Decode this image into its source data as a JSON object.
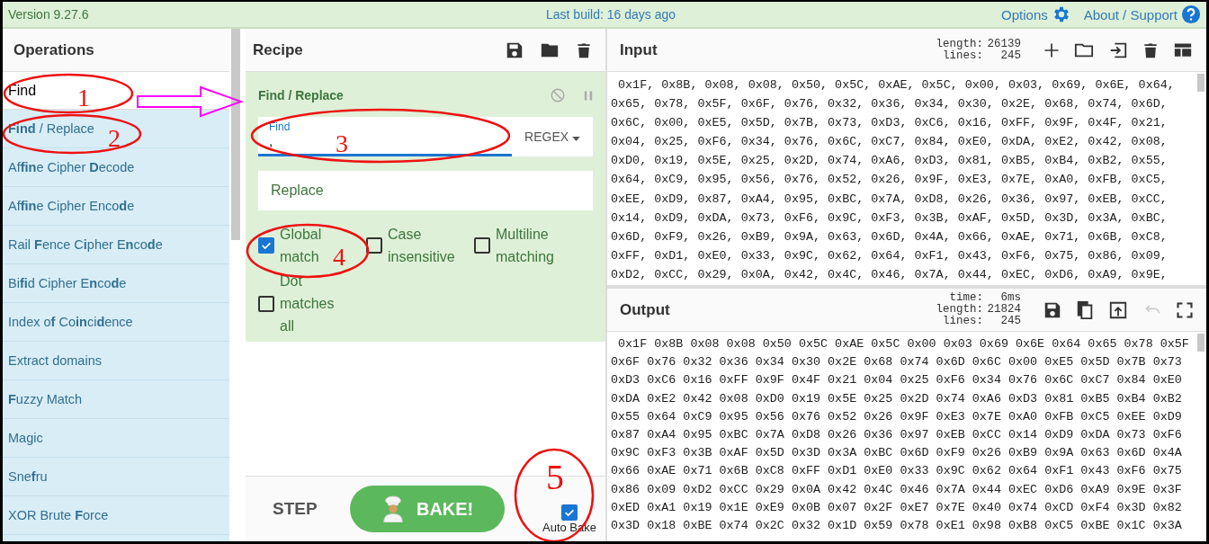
{
  "top_bar": {
    "version": "Version 9.27.6",
    "last_build": "Last build: 16 days ago",
    "options": "Options",
    "about": "About / Support"
  },
  "operations": {
    "title": "Operations",
    "search": {
      "value": "Find"
    },
    "items": [
      {
        "label": "**Find** / Replace"
      },
      {
        "label": "Af**fin**e Cipher **D**ecode"
      },
      {
        "label": "Af**fin**e Cipher Enco**d**e"
      },
      {
        "label": "Rail **F**ence C**i**pher E**n**co**d**e"
      },
      {
        "label": "Bi**fi**d Cipher E**n**co**d**e"
      },
      {
        "label": "Index o**f** Co**in**ci**d**ence"
      },
      {
        "label": "Extract domains"
      },
      {
        "label": "**F**uzzy Match"
      },
      {
        "label": "Magic"
      },
      {
        "label": "Sne**f**ru"
      },
      {
        "label": "XOR Brute **F**orce"
      }
    ]
  },
  "recipe": {
    "title": "Recipe",
    "operation": {
      "title": "Find / Replace",
      "find": {
        "label": "Find",
        "value": ",",
        "mode": "REGEX"
      },
      "replace": {
        "placeholder": "Replace"
      },
      "options": [
        {
          "label": "Global match",
          "checked": true
        },
        {
          "label": "Case insensitive",
          "checked": false
        },
        {
          "label": "Multiline matching",
          "checked": false
        },
        {
          "label": "Dot matches all",
          "checked": false
        }
      ]
    },
    "step": "STEP",
    "bake": "BAKE!",
    "auto_bake": {
      "label": "Auto Bake",
      "checked": true
    }
  },
  "input": {
    "title": "Input",
    "stats": [
      {
        "label": "length:",
        "value": "26139"
      },
      {
        "label": "lines:",
        "value": "245"
      }
    ],
    "lines": [
      " 0x1F, 0x8B, 0x08, 0x08, 0x50, 0x5C, 0xAE, 0x5C, 0x00, 0x03, 0x69, 0x6E, 0x64,",
      "0x65, 0x78, 0x5F, 0x6F, 0x76, 0x32, 0x36, 0x34, 0x30, 0x2E, 0x68, 0x74, 0x6D,",
      "0x6C, 0x00, 0xE5, 0x5D, 0x7B, 0x73, 0xD3, 0xC6, 0x16, 0xFF, 0x9F, 0x4F, 0x21,",
      "0x04, 0x25, 0xF6, 0x34, 0x76, 0x6C, 0xC7, 0x84, 0xE0, 0xDA, 0xE2, 0x42, 0x08,",
      "0xD0, 0x19, 0x5E, 0x25, 0x2D, 0x74, 0xA6, 0xD3, 0x81, 0xB5, 0xB4, 0xB2, 0x55,",
      "0x64, 0xC9, 0x95, 0x56, 0x76, 0x52, 0x26, 0x9F, 0xE3, 0x7E, 0xA0, 0xFB, 0xC5,",
      "0xEE, 0xD9, 0x87, 0xA4, 0x95, 0xBC, 0x7A, 0xD8, 0x26, 0x36, 0x97, 0xEB, 0xCC,",
      "0x14, 0xD9, 0xDA, 0x73, 0xF6, 0x9C, 0xF3, 0x3B, 0xAF, 0x5D, 0x3D, 0x3A, 0xBC,",
      "0x6D, 0xF9, 0x26, 0xB9, 0x9A, 0x63, 0x6D, 0x4A, 0x66, 0xAE, 0x71, 0x6B, 0xC8,",
      "0xFF, 0xD1, 0xE0, 0x33, 0x9C, 0x62, 0x64, 0xF1, 0x43, 0xF6, 0x75, 0x86, 0x09,",
      "0xD2, 0xCC, 0x29, 0x0A, 0x42, 0x4C, 0x46, 0x7A, 0x44, 0xEC, 0xD6, 0xA9, 0x9E,"
    ]
  },
  "output": {
    "title": "Output",
    "stats": [
      {
        "label": "time:",
        "value": "6ms"
      },
      {
        "label": "length:",
        "value": "21824"
      },
      {
        "label": "lines:",
        "value": "245"
      }
    ],
    "lines": [
      " 0x1F 0x8B 0x08 0x08 0x50 0x5C 0xAE 0x5C 0x00 0x03 0x69 0x6E 0x64 0x65 0x78 0x5F",
      "0x6F 0x76 0x32 0x36 0x34 0x30 0x2E 0x68 0x74 0x6D 0x6C 0x00 0xE5 0x5D 0x7B 0x73",
      "0xD3 0xC6 0x16 0xFF 0x9F 0x4F 0x21 0x04 0x25 0xF6 0x34 0x76 0x6C 0xC7 0x84 0xE0",
      "0xDA 0xE2 0x42 0x08 0xD0 0x19 0x5E 0x25 0x2D 0x74 0xA6 0xD3 0x81 0xB5 0xB4 0xB2",
      "0x55 0x64 0xC9 0x95 0x56 0x76 0x52 0x26 0x9F 0xE3 0x7E 0xA0 0xFB 0xC5 0xEE 0xD9",
      "0x87 0xA4 0x95 0xBC 0x7A 0xD8 0x26 0x36 0x97 0xEB 0xCC 0x14 0xD9 0xDA 0x73 0xF6",
      "0x9C 0xF3 0x3B 0xAF 0x5D 0x3D 0x3A 0xBC 0x6D 0xF9 0x26 0xB9 0x9A 0x63 0x6D 0x4A",
      "0x66 0xAE 0x71 0x6B 0xC8 0xFF 0xD1 0xE0 0x33 0x9C 0x62 0x64 0xF1 0x43 0xF6 0x75",
      "0x86 0x09 0xD2 0xCC 0x29 0x0A 0x42 0x4C 0x46 0x7A 0x44 0xEC 0xD6 0xA9 0x9E 0x3F",
      "0xED 0xA1 0x19 0x1E 0xE9 0x0B 0x07 0x2F 0xE7 0x7E 0x40 0x74 0xCD 0xF4 0x3D 0x82",
      "0x3D 0x18 0xBE 0x74 0x2C 0x32 0x1D 0x59 0x78 0xE1 0x98 0xB8 0xC5 0xBE 0x1C 0x3A"
    ]
  },
  "annotations": [
    {
      "label": "1"
    },
    {
      "label": "2"
    },
    {
      "label": "3"
    },
    {
      "label": "4"
    },
    {
      "label": "5"
    }
  ]
}
